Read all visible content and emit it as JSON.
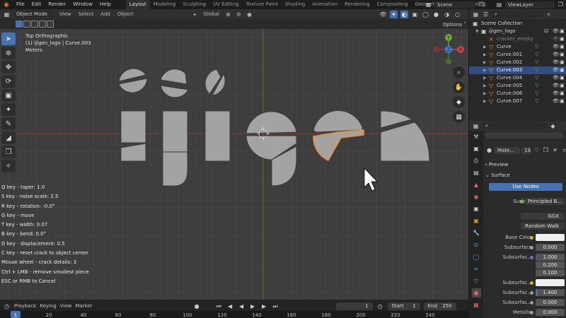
{
  "topbar": {
    "menus": [
      "File",
      "Edit",
      "Render",
      "Window",
      "Help"
    ],
    "workspaces": [
      "Layout",
      "Modeling",
      "Sculpting",
      "UV Editing",
      "Texture Paint",
      "Shading",
      "Animation",
      "Rendering",
      "Compositing",
      "Geometry Nodes",
      "Scripting"
    ],
    "active_workspace": "Layout",
    "scene_name": "Scene",
    "view_layer": "ViewLayer"
  },
  "viewport_header": {
    "mode": "Object Mode",
    "menus": [
      "View",
      "Select",
      "Add",
      "Object"
    ],
    "transform": "Global",
    "options": "Options"
  },
  "viewport_info": {
    "view": "Top Orthographic",
    "object": "(1) ijigen_logo | Curve.003",
    "units": "Meters"
  },
  "key_help": [
    "Q key - taper: 1.0",
    "S key - noise scale: 2.5",
    "R key - rotation: -0.0°",
    "G key - move",
    "T key - width: 0.07",
    "B key - bend: 0.0°",
    "D key - displacement: 0.5",
    "C key - reset crack to object center",
    "Mouse wheel - crack details: 3",
    "Ctrl + LMB - remove smallest piece",
    "ESC or RMB to Cancel"
  ],
  "gizmo": {
    "y": "Y",
    "z": "Z",
    "x": "X"
  },
  "outliner": {
    "root": "Scene Collection",
    "collection": "ijigen_logo",
    "items": [
      "cracker_empty",
      "Curve",
      "Curve.001",
      "Curve.002",
      "Curve.003",
      "Curve.004",
      "Curve.005",
      "Curve.006",
      "Curve.007"
    ],
    "selected": "Curve.003"
  },
  "properties": {
    "material_name": "Mate...",
    "material_users": "19",
    "preview_label": "Preview",
    "surface_label": "Surface",
    "use_nodes": "Use Nodes",
    "surface_field_label": "Surface",
    "surface_shader": "Principled B...",
    "distribution": "GGX",
    "subsurface_method": "Random Walk",
    "rows": [
      {
        "label": "Base Color",
        "value": ""
      },
      {
        "label": "Subsurface",
        "value": "0.000"
      },
      {
        "label": "Subsurfac...",
        "value": "1.000"
      },
      {
        "label": "",
        "value": "0.200"
      },
      {
        "label": "",
        "value": "0.100"
      },
      {
        "label": "Subsurfac...",
        "value": ""
      },
      {
        "label": "Subsurfac...",
        "value": "1.400"
      },
      {
        "label": "Subsurfac...",
        "value": "0.000"
      },
      {
        "label": "Metallic",
        "value": "0.000"
      }
    ]
  },
  "timeline": {
    "menus": [
      "Playback",
      "Keying",
      "View",
      "Marker"
    ],
    "current_frame": "1",
    "start_label": "Start",
    "start": "1",
    "end_label": "End",
    "end": "250",
    "ruler_ticks": [
      "1",
      "20",
      "40",
      "60",
      "80",
      "100",
      "120",
      "140",
      "160",
      "180",
      "200",
      "220",
      "240"
    ]
  },
  "colors": {
    "selection_blue": "#4772b3",
    "active_outline": "#e78e2f",
    "shape_fill": "#a3a3a3",
    "viewport_bg": "#3d3d3d"
  }
}
